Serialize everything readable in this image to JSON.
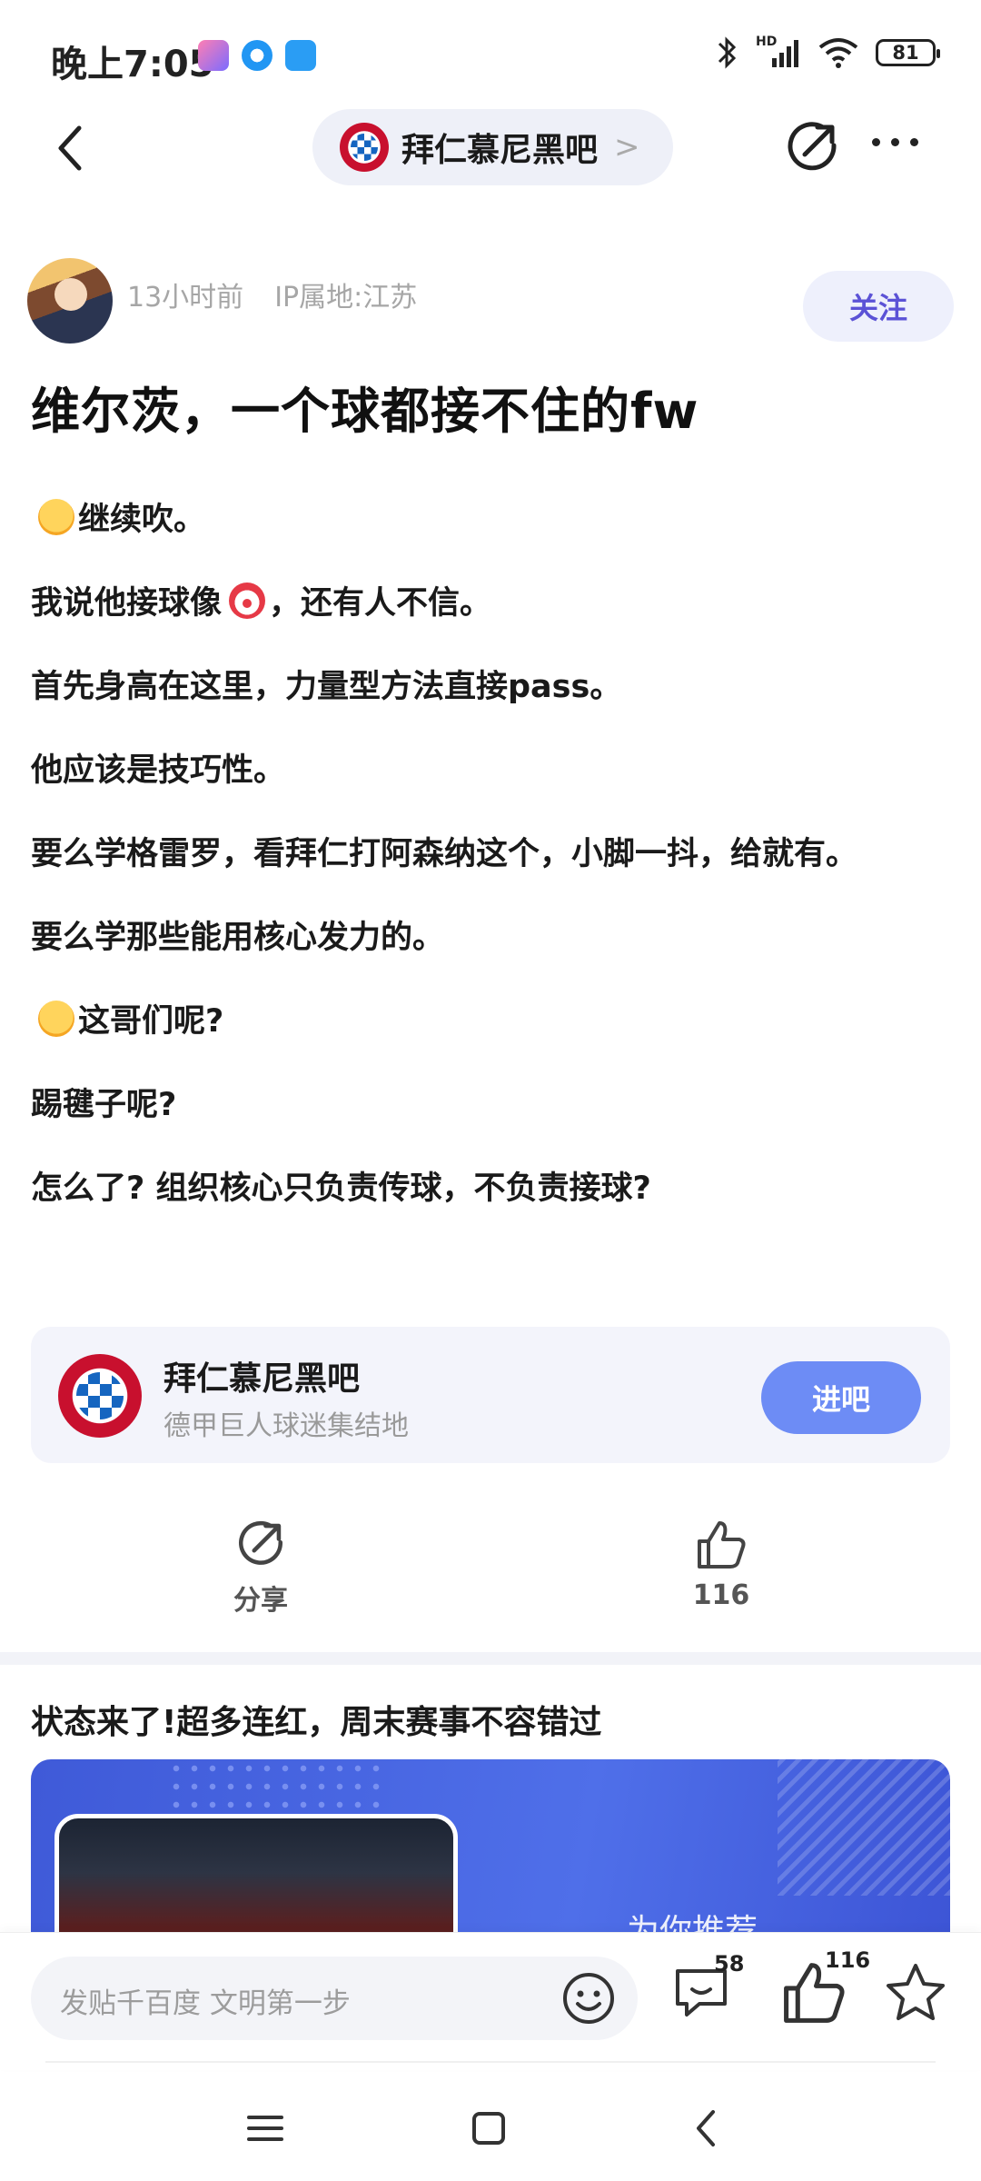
{
  "status_bar": {
    "time": "晚上7:05",
    "battery": "81",
    "network": "HD"
  },
  "nav": {
    "forum_name": "拜仁慕尼黑吧",
    "chevron": ">"
  },
  "post": {
    "time_ago": "13小时前",
    "ip_location": "IP属地:江苏",
    "follow_label": "关注",
    "title": "维尔茨，一个球都接不住的fw",
    "paragraphs": [
      "继续吹。",
      "我说他接球像",
      "，还有人不信。",
      "首先身高在这里，力量型方法直接pass。",
      "他应该是技巧性。",
      "要么学格雷罗，看拜仁打阿森纳这个，小脚一抖，给就有。",
      "要么学那些能用核心发力的。",
      "这哥们呢?",
      "踢毽子呢?",
      "怎么了? 组织核心只负责传球，不负责接球?"
    ]
  },
  "forum_card": {
    "name": "拜仁慕尼黑吧",
    "description": "德甲巨人球迷集结地",
    "enter_label": "进吧"
  },
  "actions": {
    "share_label": "分享",
    "like_count": "116"
  },
  "recommend": {
    "title": "状态来了!超多连红，周末赛事不容错过",
    "banner_text": "为你推荐"
  },
  "bottom_bar": {
    "comment_placeholder": "发贴千百度 文明第一步",
    "comment_count": "58",
    "like_count": "116"
  },
  "colors": {
    "accent": "#5b52d6",
    "enter_button": "#6d8cf5",
    "card_bg": "#f3f4fb"
  }
}
